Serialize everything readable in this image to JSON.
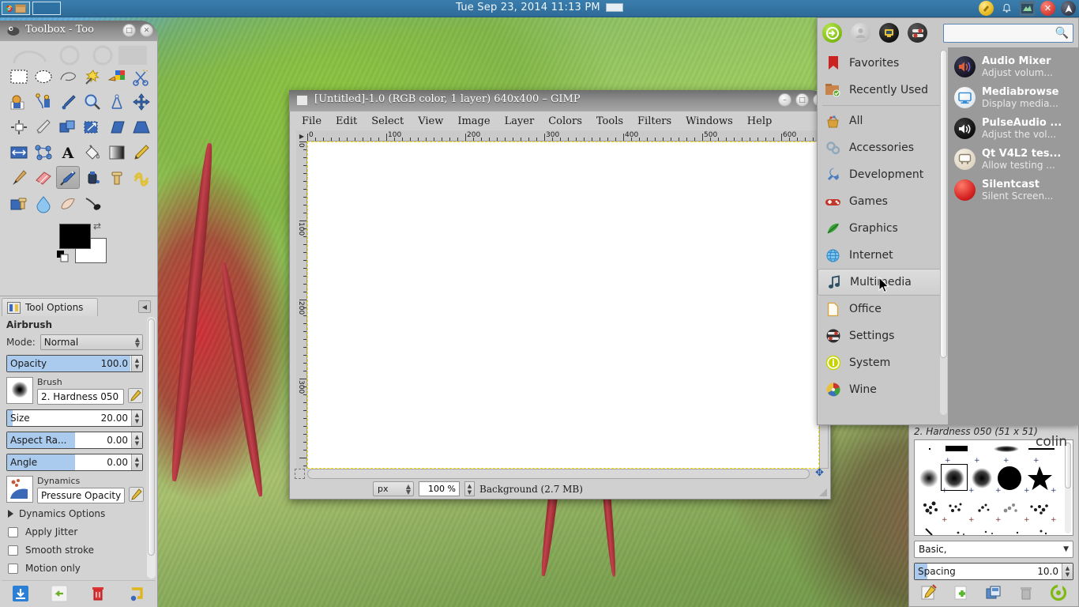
{
  "panel": {
    "clock": "Tue Sep 23, 2014   11:13 PM",
    "workspaces": [
      {
        "name": "workspace-1",
        "active": true
      },
      {
        "name": "workspace-2",
        "active": false
      }
    ],
    "tray": [
      {
        "name": "update-notifier-icon",
        "glyph": "●",
        "color": "#e8c13c"
      },
      {
        "name": "notification-bell-icon",
        "glyph": "🔔",
        "color": "#cfe0ec"
      },
      {
        "name": "network-manager-icon",
        "glyph": "■",
        "color": "#7fa7c4"
      },
      {
        "name": "close-session-icon",
        "glyph": "✕",
        "color": "#d23b33"
      },
      {
        "name": "ubuntu-one-icon",
        "glyph": "▲",
        "color": "#3b4150"
      }
    ]
  },
  "toolbox": {
    "title": "Toolbox - Too",
    "window_buttons": [
      {
        "name": "maximize-button",
        "glyph": "□"
      },
      {
        "name": "close-button",
        "glyph": "✕"
      }
    ],
    "tools": [
      "rect-select-tool",
      "ellipse-select-tool",
      "free-select-tool",
      "fuzzy-select-tool",
      "select-by-color-tool",
      "scissors-select-tool",
      "foreground-select-tool",
      "paths-tool",
      "color-picker-tool",
      "zoom-tool",
      "measure-tool",
      "move-tool",
      "alignment-tool",
      "crop-tool",
      "rotate-tool",
      "scale-tool",
      "shear-tool",
      "perspective-tool",
      "flip-tool",
      "cage-transform-tool",
      "text-tool",
      "bucket-fill-tool",
      "blend-tool",
      "pencil-tool",
      "paintbrush-tool",
      "eraser-tool",
      "airbrush-tool",
      "ink-tool",
      "clone-tool",
      "heal-tool",
      "perspective-clone-tool",
      "blur-sharpen-tool",
      "smudge-tool",
      "dodge-burn-tool"
    ],
    "selected_tool": "airbrush-tool",
    "foreground_color": "#000000",
    "background_color": "#ffffff"
  },
  "tool_options": {
    "tab_label": "Tool Options",
    "tool_name": "Airbrush",
    "mode_label": "Mode:",
    "mode_value": "Normal",
    "opacity_label": "Opacity",
    "opacity_value": "100.0",
    "brush_label": "Brush",
    "brush_value": "2. Hardness 050",
    "size_label": "Size",
    "size_value": "20.00",
    "aspect_label": "Aspect Ra...",
    "aspect_value": "0.00",
    "angle_label": "Angle",
    "angle_value": "0.00",
    "dynamics_label": "Dynamics",
    "dynamics_value": "Pressure Opacity",
    "dynamics_options_label": "Dynamics Options",
    "checkboxes": [
      {
        "label": "Apply Jitter",
        "checked": false
      },
      {
        "label": "Smooth stroke",
        "checked": false
      },
      {
        "label": "Motion only",
        "checked": false
      }
    ],
    "footer_buttons": [
      {
        "name": "save-tool-preset-button",
        "color": "#2b7fd4"
      },
      {
        "name": "restore-tool-preset-button",
        "color": "#8ab52e"
      },
      {
        "name": "delete-tool-preset-button",
        "color": "#cc2222"
      },
      {
        "name": "reset-tool-options-button",
        "color": "#e3b417"
      }
    ]
  },
  "image_window": {
    "title": "[Untitled]-1.0 (RGB color, 1 layer) 640x400 – GIMP",
    "window_buttons": [
      {
        "name": "minimize-button",
        "glyph": "–"
      },
      {
        "name": "maximize-button",
        "glyph": "□"
      },
      {
        "name": "close-button",
        "glyph": "✕"
      }
    ],
    "menus": [
      "File",
      "Edit",
      "Select",
      "View",
      "Image",
      "Layer",
      "Colors",
      "Tools",
      "Filters",
      "Windows",
      "Help"
    ],
    "h_ruler_labels": [
      "0",
      "100",
      "200",
      "300",
      "400",
      "500",
      "600"
    ],
    "v_ruler_labels": [
      "0",
      "100",
      "200",
      "300"
    ],
    "status": {
      "unit": "px",
      "zoom": "100 %",
      "text": "Background (2.7 MB)"
    }
  },
  "app_menu": {
    "header_icons": [
      {
        "name": "logout-icon",
        "glyph": "→",
        "color": "#7fba14"
      },
      {
        "name": "user-account-icon",
        "glyph": "👤",
        "color": "#c0c0c0"
      },
      {
        "name": "lock-screen-icon",
        "glyph": "🖥",
        "color": "#1e1e1e"
      },
      {
        "name": "settings-manager-icon",
        "glyph": "≡",
        "color": "#3b3b3b"
      }
    ],
    "search_placeholder": "",
    "search_value": "",
    "categories": [
      {
        "label": "Favorites",
        "icon": "bookmark-icon",
        "color": "#cc2222",
        "selected": false
      },
      {
        "label": "Recently Used",
        "icon": "recent-folder-icon",
        "color": "#c8844a",
        "selected": false
      },
      {
        "label": "All",
        "icon": "all-applications-icon",
        "color": "#d8a13c",
        "selected": false
      },
      {
        "label": "Accessories",
        "icon": "accessories-icon",
        "color": "#8fa6b8",
        "selected": false
      },
      {
        "label": "Development",
        "icon": "wrench-icon",
        "color": "#4a7fc1",
        "selected": false
      },
      {
        "label": "Games",
        "icon": "gamepad-icon",
        "color": "#c0392b",
        "selected": false
      },
      {
        "label": "Graphics",
        "icon": "graphics-icon",
        "color": "#3aa33a",
        "selected": false
      },
      {
        "label": "Internet",
        "icon": "globe-icon",
        "color": "#4aa3dd",
        "selected": false
      },
      {
        "label": "Multimedia",
        "icon": "music-note-icon",
        "color": "#2b4f63",
        "selected": true
      },
      {
        "label": "Office",
        "icon": "document-icon",
        "color": "#d8a13c",
        "selected": false
      },
      {
        "label": "Settings",
        "icon": "settings-icon",
        "color": "#2e2e2e",
        "selected": false
      },
      {
        "label": "System",
        "icon": "system-info-icon",
        "color": "#c8d400",
        "selected": false
      },
      {
        "label": "Wine",
        "icon": "wine-icon",
        "color": "#cc3333",
        "selected": false
      }
    ],
    "applications": [
      {
        "name": "Audio Mixer",
        "desc": "Adjust volum...",
        "icon": "audio-mixer-icon",
        "color": "#1a1a2e"
      },
      {
        "name": "Mediabrowse",
        "desc": "Display media...",
        "icon": "mediabrowser-icon",
        "color": "#e8eef2"
      },
      {
        "name": "PulseAudio ...",
        "desc": "Adjust the vol...",
        "icon": "pulseaudio-icon",
        "color": "#121212"
      },
      {
        "name": "Qt V4L2 tes...",
        "desc": "Allow testing ...",
        "icon": "qt-v4l2-icon",
        "color": "#e4ded3"
      },
      {
        "name": "Silentcast",
        "desc": "Silent Screen...",
        "icon": "silentcast-icon",
        "color": "#d42020"
      }
    ],
    "username": "colin"
  },
  "brush_dock": {
    "title": "2. Hardness 050 (51 x 51)",
    "filter_value": "Basic,",
    "spacing_label": "Spacing",
    "spacing_value": "10.0",
    "footer_buttons": [
      {
        "name": "edit-brush-button",
        "color": "#d8a13c"
      },
      {
        "name": "new-brush-button",
        "color": "#5ab52e"
      },
      {
        "name": "duplicate-brush-button",
        "color": "#3a73b8"
      },
      {
        "name": "delete-brush-button",
        "color": "#9b9b9b"
      },
      {
        "name": "refresh-brushes-button",
        "color": "#7fba14"
      }
    ]
  }
}
